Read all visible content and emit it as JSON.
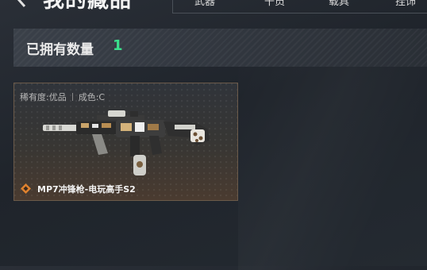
{
  "header": {
    "title": "我的藏品",
    "tabs": [
      {
        "label": "武器"
      },
      {
        "label": "干员"
      },
      {
        "label": "载具"
      },
      {
        "label": "挂饰"
      }
    ]
  },
  "owned": {
    "label": "已拥有数量",
    "count": "1",
    "count_color": "#3be08c"
  },
  "items": [
    {
      "rarity_label": "稀有度:优品",
      "condition_label": "成色:C",
      "name": "MP7冲锋枪-电玩高手S2",
      "rarity_color": "#e0822e",
      "icon": "rarity-diamond-icon"
    }
  ]
}
